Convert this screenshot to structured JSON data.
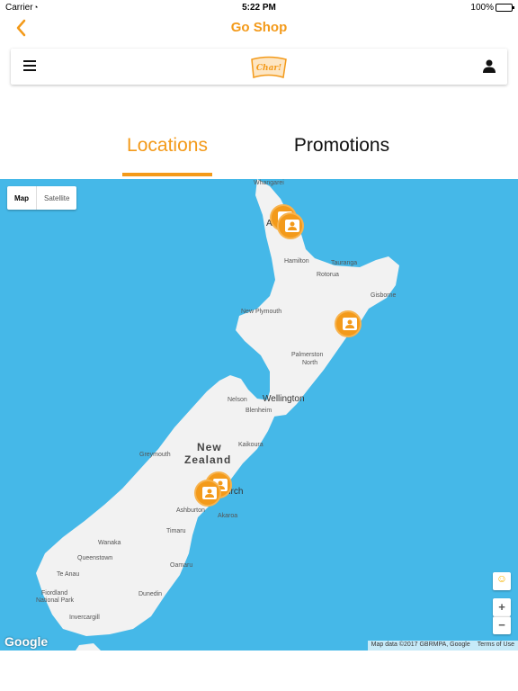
{
  "status_bar": {
    "carrier": "Carrier",
    "time": "5:22 PM",
    "battery": "100%"
  },
  "nav": {
    "title": "Go Shop",
    "back_icon": "chevron-left-icon"
  },
  "appbar": {
    "logo_text": "Char!",
    "menu_icon": "hamburger-icon",
    "user_icon": "user-icon"
  },
  "tabs": {
    "locations": "Locations",
    "promotions": "Promotions",
    "active": "locations"
  },
  "map": {
    "toggle_map": "Map",
    "toggle_satellite": "Satellite",
    "country_line1": "New",
    "country_line2": "Zealand",
    "labels": {
      "whangarei": "Whangarei",
      "auckland": "Au",
      "hamilton": "Hamilton",
      "tauranga": "Tauranga",
      "rotorua": "Rotorua",
      "gisborne": "Gisborne",
      "new_plymouth": "New Plymouth",
      "palmerston": "Palmerston",
      "palmerston2": "North",
      "nelson": "Nelson",
      "wellington": "Wellington",
      "blenheim": "Blenheim",
      "kaikoura": "Kaikoura",
      "greymouth": "Greymouth",
      "christchurch": "urch",
      "ashburton": "Ashburton",
      "akaroa": "Akaroa",
      "timaru": "Timaru",
      "wanaka": "Wanaka",
      "queenstown": "Queenstown",
      "te_anau": "Te Anau",
      "oamaru": "Oamaru",
      "fiordland": "Fiordland",
      "fiordland2": "National Park",
      "dunedin": "Dunedin",
      "invercargill": "Invercargill"
    },
    "google": "Google",
    "attribution": "Map data ©2017 GBRMPA, Google",
    "terms": "Terms of Use",
    "zoom_in": "+",
    "zoom_out": "−",
    "colors": {
      "water": "#45b8e8",
      "land": "#f2f2f2",
      "accent": "#f39a1a"
    }
  }
}
